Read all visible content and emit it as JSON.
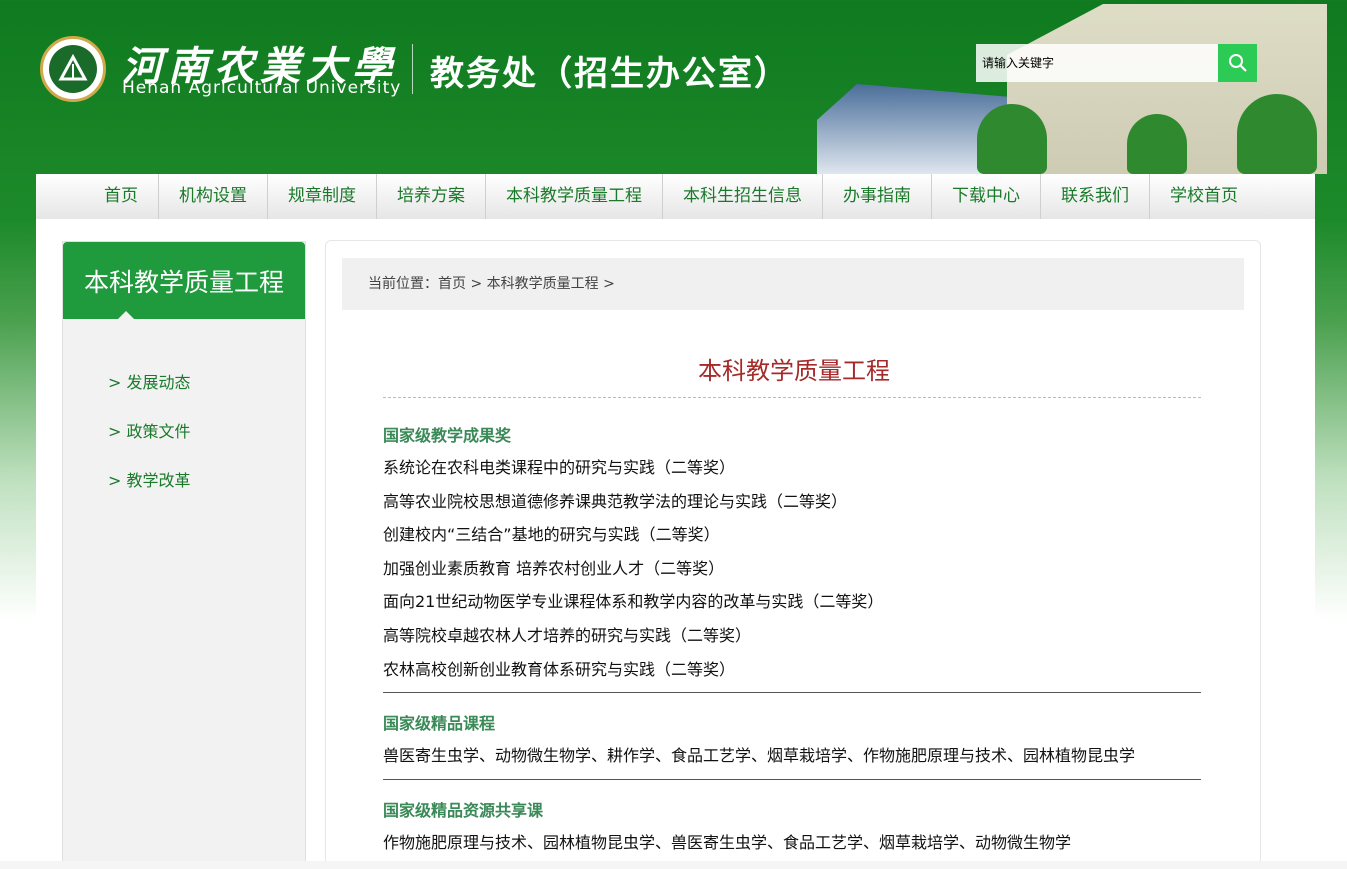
{
  "header": {
    "logo_text": "河南农业大学",
    "univ_cn": "河南农業大學",
    "univ_en": "Henan Agricultural University",
    "dept": "教务处（招生办公室）",
    "search_placeholder": "请输入关键字",
    "search_icon": "magnifier-icon"
  },
  "nav": {
    "items": [
      "首页",
      "机构设置",
      "规章制度",
      "培养方案",
      "本科教学质量工程",
      "本科生招生信息",
      "办事指南",
      "下载中心",
      "联系我们",
      "学校首页"
    ]
  },
  "sidebar": {
    "title": "本科教学质量工程",
    "items": [
      "> 发展动态",
      "> 政策文件",
      "> 教学改革"
    ]
  },
  "breadcrumb": {
    "text": "当前位置：首页 > 本科教学质量工程 >"
  },
  "content": {
    "title": "本科教学质量工程",
    "sections": [
      {
        "title": "国家级教学成果奖",
        "lines": [
          "系统论在农科电类课程中的研究与实践（二等奖）",
          "高等农业院校思想道德修养课典范教学法的理论与实践（二等奖）",
          "创建校内“三结合”基地的研究与实践（二等奖）",
          "加强创业素质教育 培养农村创业人才（二等奖）",
          "面向21世纪动物医学专业课程体系和教学内容的改革与实践（二等奖）",
          "高等院校卓越农林人才培养的研究与实践（二等奖）",
          "农林高校创新创业教育体系研究与实践（二等奖）"
        ]
      },
      {
        "title": "国家级精品课程",
        "lines": [
          "兽医寄生虫学、动物微生物学、耕作学、食品工艺学、烟草栽培学、作物施肥原理与技术、园林植物昆虫学"
        ]
      },
      {
        "title": "国家级精品资源共享课",
        "lines": [
          "作物施肥原理与技术、园林植物昆虫学、兽医寄生虫学、食品工艺学、烟草栽培学、动物微生物学"
        ]
      }
    ]
  }
}
